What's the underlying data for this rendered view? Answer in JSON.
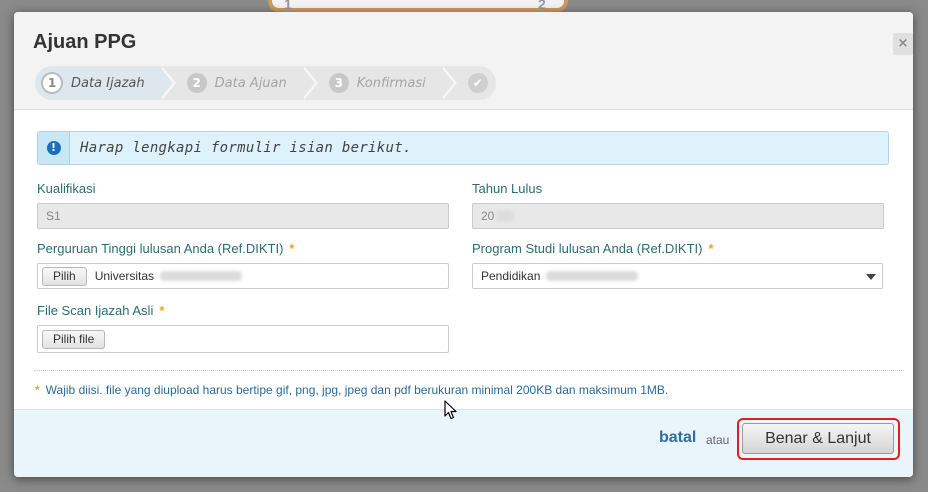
{
  "background": {
    "step1_num": "1",
    "step2_num": "2"
  },
  "modal": {
    "title": "Ajuan PPG",
    "close_glyph": "×",
    "wizard": [
      {
        "num": "1",
        "label": "Data Ijazah",
        "active": true
      },
      {
        "num": "2",
        "label": "Data Ajuan",
        "active": false
      },
      {
        "num": "3",
        "label": "Konfirmasi",
        "active": false
      }
    ],
    "wizard_done_glyph": "✔",
    "alert": {
      "icon": "!",
      "text": "Harap lengkapi formulir isian berikut."
    },
    "fields": {
      "kualifikasi": {
        "label": "Kualifikasi",
        "value": "S1"
      },
      "tahun_lulus": {
        "label": "Tahun Lulus",
        "value": "20"
      },
      "perguruan_tinggi": {
        "label": "Perguruan Tinggi lulusan Anda (Ref.DIKTI)",
        "required": "*",
        "button": "Pilih",
        "value": "Universitas"
      },
      "program_studi": {
        "label": "Program Studi lulusan Anda (Ref.DIKTI)",
        "required": "*",
        "value": "Pendidikan"
      },
      "file_scan": {
        "label": "File Scan Ijazah Asli",
        "required": "*",
        "button": "Pilih file"
      }
    },
    "note": {
      "star": "*",
      "text": "Wajib diisi. file yang diupload harus bertipe gif, png, jpg, jpeg dan pdf berukuran minimal 200KB dan maksimum 1MB."
    },
    "footer": {
      "cancel_label": "batal",
      "or_label": "atau",
      "next_label": "Benar & Lanjut"
    }
  },
  "colors": {
    "accent_teal": "#2c6e6e",
    "link_blue": "#2f6ea5",
    "required_orange": "#f0a020",
    "highlight_red": "#e02020"
  }
}
